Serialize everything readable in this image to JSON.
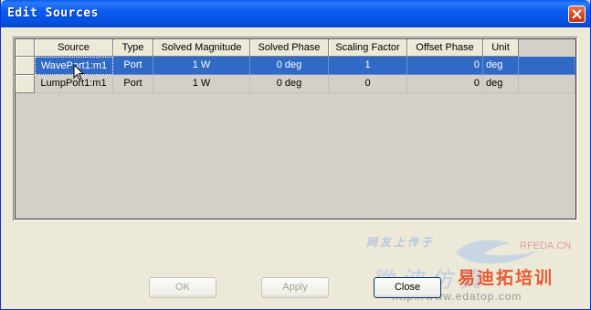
{
  "window": {
    "title": "Edit Sources",
    "close_icon": "close-icon",
    "colors": {
      "titlebar": "#0a5bf0",
      "face": "#ece9d8",
      "selection": "#316ac5",
      "close": "#d8461f"
    }
  },
  "grid": {
    "columns": [
      "Source",
      "Type",
      "Solved Magnitude",
      "Solved Phase",
      "Scaling Factor",
      "Offset Phase",
      "Unit"
    ],
    "rows": [
      {
        "source": "WavePort1:m1",
        "type": "Port",
        "magnitude": "1 W",
        "phase": "0 deg",
        "scaling": "1",
        "offset": "0",
        "unit": "deg",
        "selected": true
      },
      {
        "source": "LumpPort1:m1",
        "type": "Port",
        "magnitude": "1 W",
        "phase": "0 deg",
        "scaling": "0",
        "offset": "0",
        "unit": "deg",
        "selected": false
      }
    ]
  },
  "buttons": {
    "ok": "OK",
    "apply": "Apply",
    "close": "Close"
  },
  "watermark": {
    "line1": "网友上传于",
    "line2": "微波仿真",
    "brand": "易迪拓培训",
    "site": "http://www.edatop.com",
    "logo": "RFEDA.CN"
  }
}
